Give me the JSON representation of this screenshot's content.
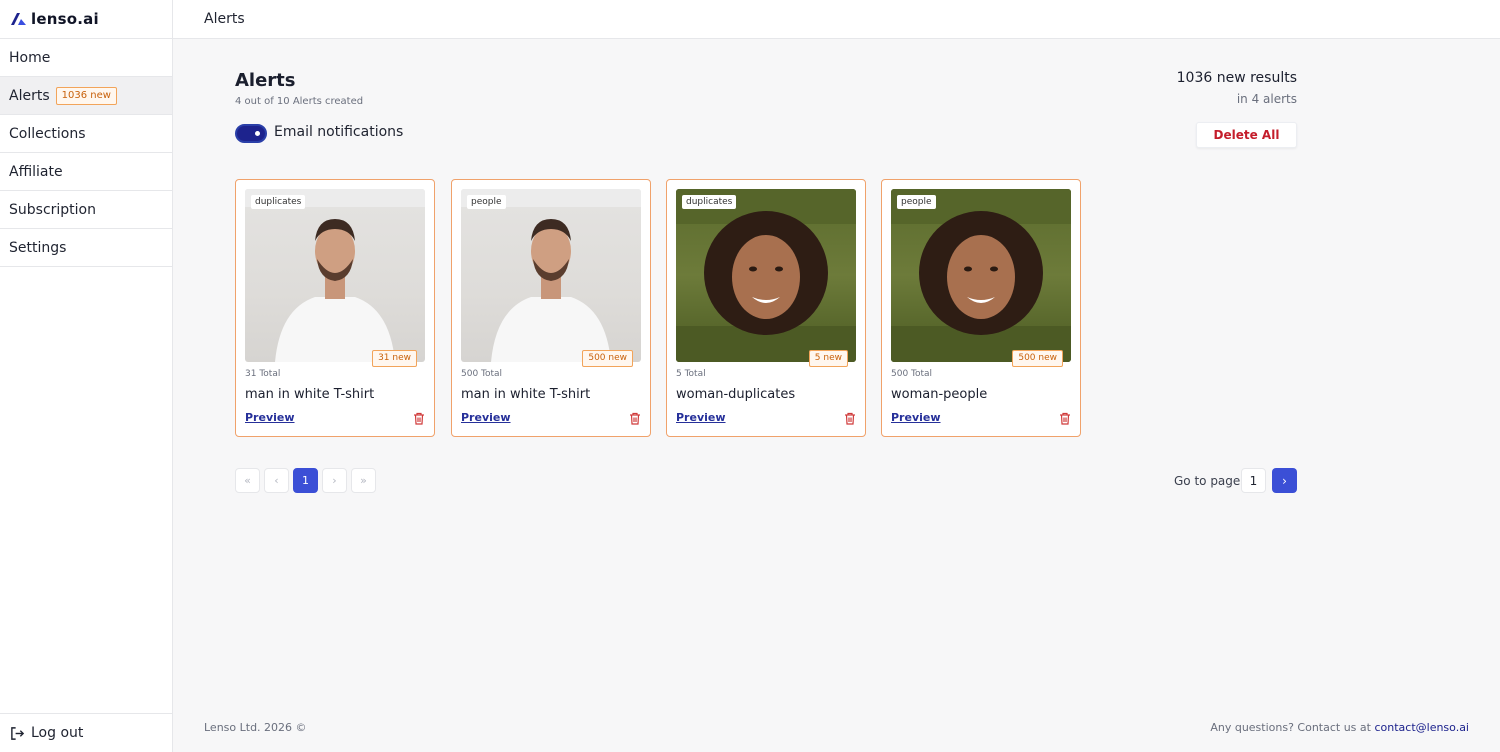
{
  "sidebar": {
    "logo_text": "lenso.ai",
    "items": [
      {
        "label": "Home"
      },
      {
        "label": "Alerts",
        "badge": "1036 new"
      },
      {
        "label": "Collections"
      },
      {
        "label": "Affiliate"
      },
      {
        "label": "Subscription"
      },
      {
        "label": "Settings"
      }
    ],
    "logout_label": "Log out"
  },
  "topbar": {
    "title": "Alerts"
  },
  "header": {
    "title": "Alerts",
    "subtitle": "4 out of 10 Alerts created",
    "email_toggle_label": "Email notifications",
    "email_toggle_on": true,
    "results_title": "1036 new results",
    "results_sub": "in 4 alerts",
    "delete_all_label": "Delete All"
  },
  "cards": [
    {
      "tag": "duplicates",
      "new_badge": "31 new",
      "total": "31 Total",
      "title": "man in white T-shirt",
      "preview": "Preview",
      "image": "man"
    },
    {
      "tag": "people",
      "new_badge": "500 new",
      "total": "500 Total",
      "title": "man in white T-shirt",
      "preview": "Preview",
      "image": "man"
    },
    {
      "tag": "duplicates",
      "new_badge": "5 new",
      "total": "5 Total",
      "title": "woman-duplicates",
      "preview": "Preview",
      "image": "woman"
    },
    {
      "tag": "people",
      "new_badge": "500 new",
      "total": "500 Total",
      "title": "woman-people",
      "preview": "Preview",
      "image": "woman"
    }
  ],
  "pagination": {
    "current_page": "1",
    "first_icon": "«",
    "prev_icon": "‹",
    "next_icon": "›",
    "last_icon": "»",
    "goto_label": "Go to page:",
    "goto_value": "1",
    "goto_button_icon": "›"
  },
  "footer": {
    "copyright": "Lenso Ltd. 2026 ©",
    "contact_prefix": "Any questions? Contact us at ",
    "contact_email": "contact@lenso.ai"
  },
  "colors": {
    "accent": "#1d238d",
    "badge_orange": "#c8620d",
    "danger": "#c41d2b"
  }
}
